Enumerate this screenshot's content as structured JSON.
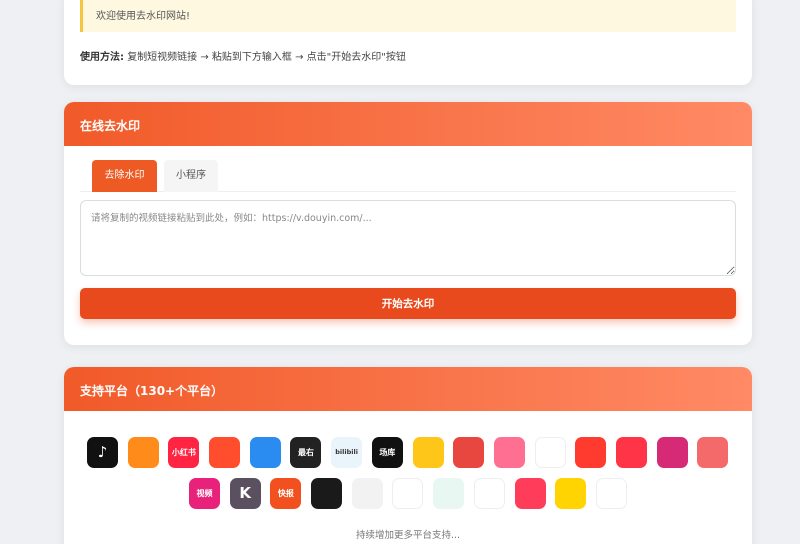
{
  "intro": {
    "notice": "欢迎使用去水印网站!",
    "usage_label": "使用方法:",
    "usage_text": "复制短视频链接 → 粘贴到下方输入框 → 点击\"开始去水印\"按钮"
  },
  "tool": {
    "title": "在线去水印",
    "tabs": [
      {
        "label": "去除水印",
        "active": true
      },
      {
        "label": "小程序",
        "active": false
      }
    ],
    "input_placeholder": "请将复制的视频链接粘贴到此处，例如：https://v.douyin.com/...",
    "button_label": "开始去水印"
  },
  "platforms": {
    "title": "支持平台（130+个平台）",
    "row1": [
      {
        "icon": "douyin-icon",
        "text": "♪",
        "color": "#111111"
      },
      {
        "icon": "kuaishou-grid-icon",
        "text": "",
        "color": "#ff8c1a"
      },
      {
        "icon": "xiaohongshu-icon",
        "text": "小红书",
        "color": "#ff2442"
      },
      {
        "icon": "cartoon-app-icon",
        "text": "",
        "color": "#ff4d2e"
      },
      {
        "icon": "play-circle-blue-icon",
        "text": "",
        "color": "#2a8cf0"
      },
      {
        "icon": "zuiyou-icon",
        "text": "最右",
        "color": "#222222"
      },
      {
        "icon": "bilibili-icon",
        "text": "bilibili",
        "color": "#eaf4fb"
      },
      {
        "icon": "changku-icon",
        "text": "场库",
        "color": "#111111"
      },
      {
        "icon": "yellow-a-icon",
        "text": "",
        "color": "#ffc61a"
      },
      {
        "icon": "monkey-icon",
        "text": "",
        "color": "#e8473f"
      },
      {
        "icon": "face-pink-icon",
        "text": "",
        "color": "#ff6f91"
      },
      {
        "icon": "colorful-play-icon",
        "text": "",
        "color": "#ffffff"
      },
      {
        "icon": "red-play-icon",
        "text": "",
        "color": "#ff3b30"
      },
      {
        "icon": "target-play-icon",
        "text": "",
        "color": "#ff3547"
      },
      {
        "icon": "instagram-icon",
        "text": "",
        "color": "#d62976"
      },
      {
        "icon": "funny-face-icon",
        "text": "",
        "color": "#f46a6a"
      }
    ],
    "row2": [
      {
        "icon": "shipin-icon",
        "text": "视频",
        "color": "#e8227a"
      },
      {
        "icon": "k-icon",
        "text": "K",
        "color": "#5a5060"
      },
      {
        "icon": "kuaibao-icon",
        "text": "快报",
        "color": "#f3501f"
      },
      {
        "icon": "tv-play-icon",
        "text": "",
        "color": "#1a1a1a"
      },
      {
        "icon": "camera-eye-icon",
        "text": "",
        "color": "#f2f2f2"
      },
      {
        "icon": "yellow-play-bag-icon",
        "text": "",
        "color": "#ffffff"
      },
      {
        "icon": "bowl-icon",
        "text": "",
        "color": "#e8f7f2"
      },
      {
        "icon": "city-skyline-icon",
        "text": "",
        "color": "#ffffff"
      },
      {
        "icon": "video-camera-icon",
        "text": "",
        "color": "#ff3d5a"
      },
      {
        "icon": "yellow-play-ring-icon",
        "text": "",
        "color": "#ffd400"
      },
      {
        "icon": "chat-bubble-icon",
        "text": "",
        "color": "#ffffff"
      }
    ],
    "more": "持续增加更多平台支持..."
  }
}
